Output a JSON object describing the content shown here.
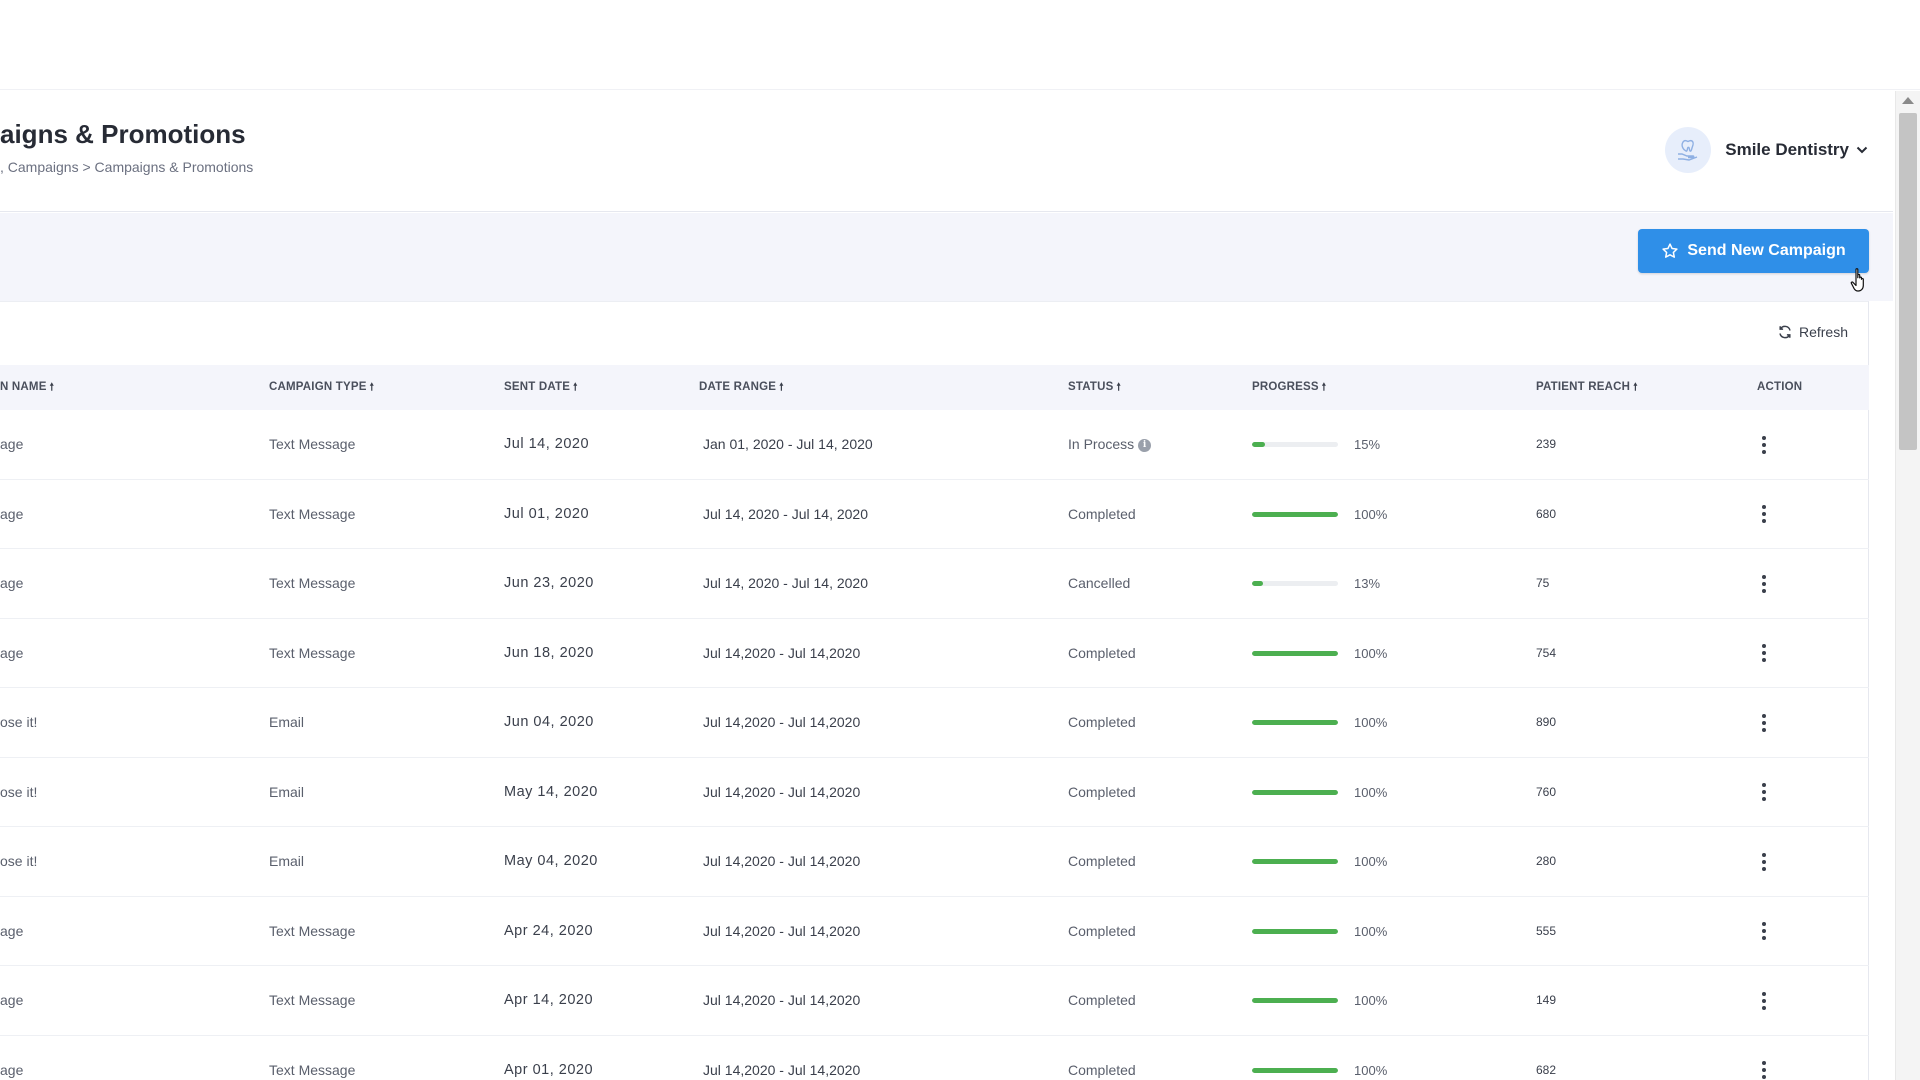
{
  "header": {
    "title": "aigns & Promotions",
    "breadcrumb": ", Campaigns > Campaigns & Promotions"
  },
  "account": {
    "name": "Smile Dentistry",
    "avatar_icon": "tooth-hand-icon"
  },
  "toolbar": {
    "send_new_campaign": "Send New Campaign",
    "send_icon": "star-icon"
  },
  "table": {
    "refresh_label": "Refresh",
    "columns": {
      "name": "N NAME",
      "type": "CAMPAIGN TYPE",
      "sent": "SENT DATE",
      "range": "DATE RANGE",
      "status": "STATUS",
      "progress": "PROGRESS",
      "reach": "PATIENT REACH",
      "action": "ACTION"
    },
    "sort_glyph": "🠕",
    "rows": [
      {
        "name": "age",
        "type": "Text Message",
        "sent": "Jul 14, 2020",
        "range": "Jan 01, 2020 - Jul 14, 2020",
        "status": "In Process",
        "info": true,
        "progress": 15,
        "progress_label": "15%",
        "reach": "239"
      },
      {
        "name": "age",
        "type": "Text Message",
        "sent": "Jul 01, 2020",
        "range": "Jul 14, 2020 - Jul 14, 2020",
        "status": "Completed",
        "progress": 100,
        "progress_label": "100%",
        "reach": "680"
      },
      {
        "name": "age",
        "type": "Text Message",
        "sent": "Jun 23, 2020",
        "range": "Jul 14, 2020 - Jul 14, 2020",
        "status": "Cancelled",
        "progress": 13,
        "progress_label": "13%",
        "reach": "75"
      },
      {
        "name": "age",
        "type": "Text Message",
        "sent": "Jun 18, 2020",
        "range": "Jul 14,2020 - Jul 14,2020",
        "status": "Completed",
        "progress": 100,
        "progress_label": "100%",
        "reach": "754"
      },
      {
        "name": "ose it!",
        "type": "Email",
        "sent": "Jun 04, 2020",
        "range": "Jul 14,2020 - Jul 14,2020",
        "status": "Completed",
        "progress": 100,
        "progress_label": "100%",
        "reach": "890"
      },
      {
        "name": "ose it!",
        "type": "Email",
        "sent": "May 14, 2020",
        "range": "Jul 14,2020 - Jul 14,2020",
        "status": "Completed",
        "progress": 100,
        "progress_label": "100%",
        "reach": "760"
      },
      {
        "name": "ose it!",
        "type": "Email",
        "sent": "May 04, 2020",
        "range": "Jul 14,2020 - Jul 14,2020",
        "status": "Completed",
        "progress": 100,
        "progress_label": "100%",
        "reach": "280"
      },
      {
        "name": "age",
        "type": "Text Message",
        "sent": "Apr 24, 2020",
        "range": "Jul 14,2020 - Jul 14,2020",
        "status": "Completed",
        "progress": 100,
        "progress_label": "100%",
        "reach": "555"
      },
      {
        "name": "age",
        "type": "Text Message",
        "sent": "Apr 14, 2020",
        "range": "Jul 14,2020 - Jul 14,2020",
        "status": "Completed",
        "progress": 100,
        "progress_label": "100%",
        "reach": "149"
      },
      {
        "name": "age",
        "type": "Text Message",
        "sent": "Apr 01, 2020",
        "range": "Jul 14,2020 - Jul 14,2020",
        "status": "Completed",
        "progress": 100,
        "progress_label": "100%",
        "reach": "682"
      }
    ]
  },
  "colors": {
    "accent": "#2f8fe8",
    "progress": "#4caf50",
    "header_bg": "#f4f5fb"
  }
}
